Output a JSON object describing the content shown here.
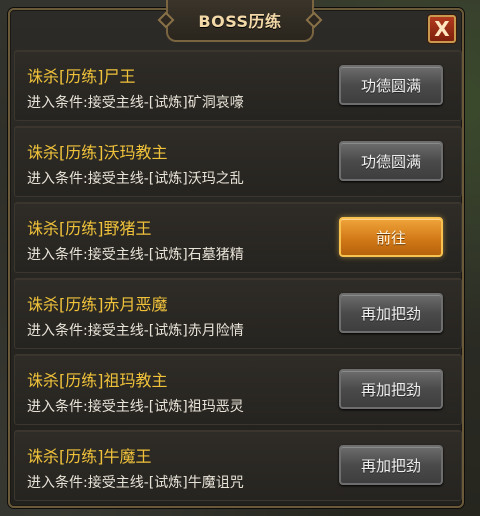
{
  "window": {
    "title": "BOSS历练",
    "close_label": "X"
  },
  "quests": [
    {
      "title": "诛杀[历练]尸王",
      "condition": "进入条件:接受主线-[试炼]矿洞哀嚎",
      "button": "功德圆满",
      "button_style": "gray"
    },
    {
      "title": "诛杀[历练]沃玛教主",
      "condition": "进入条件:接受主线-[试炼]沃玛之乱",
      "button": "功德圆满",
      "button_style": "gray"
    },
    {
      "title": "诛杀[历练]野猪王",
      "condition": "进入条件:接受主线-[试炼]石墓猪精",
      "button": "前往",
      "button_style": "gold"
    },
    {
      "title": "诛杀[历练]赤月恶魔",
      "condition": "进入条件:接受主线-[试炼]赤月险情",
      "button": "再加把劲",
      "button_style": "gray"
    },
    {
      "title": "诛杀[历练]祖玛教主",
      "condition": "进入条件:接受主线-[试炼]祖玛恶灵",
      "button": "再加把劲",
      "button_style": "gray"
    },
    {
      "title": "诛杀[历练]牛魔王",
      "condition": "进入条件:接受主线-[试炼]牛魔诅咒",
      "button": "再加把劲",
      "button_style": "gray"
    }
  ],
  "colors": {
    "title_text": "#f3d9a8",
    "quest_title": "#f0c23a",
    "condition_text": "#e8e3d8",
    "gold_button": "#d27a18",
    "close_button": "#b23a1e"
  }
}
